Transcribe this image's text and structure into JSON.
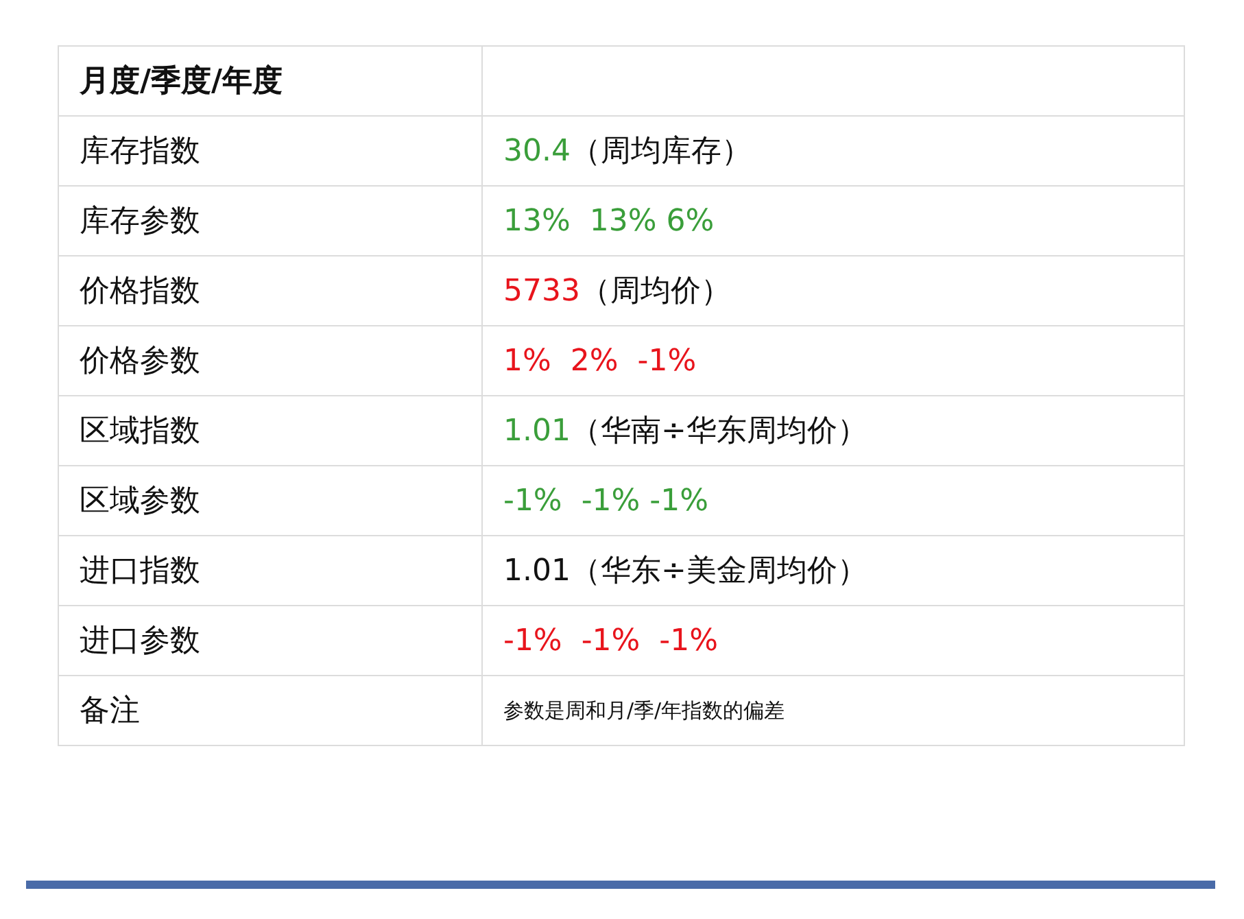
{
  "table": {
    "header": {
      "label": "月度/季度/年度"
    },
    "rows": [
      {
        "label": "库存指数",
        "kind": "parts",
        "parts": [
          {
            "text": "30.4",
            "color": "#3a9e3a"
          },
          {
            "text": "（周均库存）",
            "color": "#111111"
          }
        ]
      },
      {
        "label": "库存参数",
        "kind": "parts",
        "parts": [
          {
            "text": "13%  13% 6%",
            "color": "#3a9e3a"
          }
        ]
      },
      {
        "label": "价格指数",
        "kind": "parts",
        "parts": [
          {
            "text": "5733",
            "color": "#e8141c"
          },
          {
            "text": "（周均价）",
            "color": "#111111"
          }
        ]
      },
      {
        "label": "价格参数",
        "kind": "parts",
        "parts": [
          {
            "text": "1%  2%  -1%",
            "color": "#e8141c"
          }
        ]
      },
      {
        "label": "区域指数",
        "kind": "parts",
        "parts": [
          {
            "text": "1.01",
            "color": "#3a9e3a"
          },
          {
            "text": "（华南÷华东周均价）",
            "color": "#111111"
          }
        ]
      },
      {
        "label": "区域参数",
        "kind": "parts",
        "parts": [
          {
            "text": "-1%  -1% -1%",
            "color": "#3a9e3a"
          }
        ]
      },
      {
        "label": "进口指数",
        "kind": "parts",
        "parts": [
          {
            "text": "1.01（华东÷美金周均价）",
            "color": "#111111"
          }
        ]
      },
      {
        "label": "进口参数",
        "kind": "parts",
        "parts": [
          {
            "text": "-1%  -1%  -1%",
            "color": "#e8141c"
          }
        ]
      },
      {
        "label": "备注",
        "kind": "note",
        "parts": [
          {
            "text": "参数是周和月/季/年指数的偏差",
            "color": "#111111"
          }
        ]
      }
    ]
  }
}
